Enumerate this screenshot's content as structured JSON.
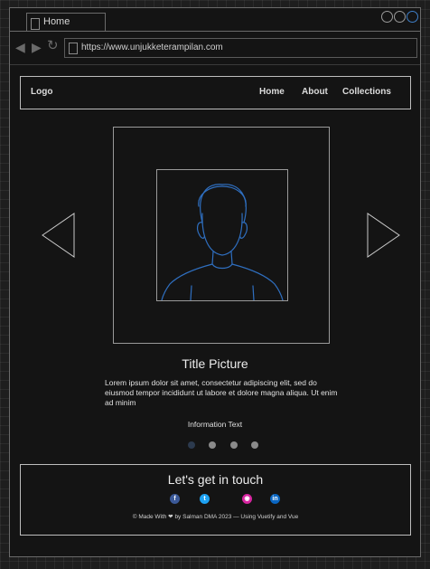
{
  "browser": {
    "tab_title": "Home",
    "url": "https://www.unjukketerampilan.com"
  },
  "header": {
    "logo": "Logo",
    "nav": [
      "Home",
      "About",
      "Collections"
    ]
  },
  "carousel": {
    "title": "Title Picture",
    "description": "Lorem ipsum dolor sit amet, consectetur adipiscing elit, sed do eiusmod tempor incididunt ut labore et dolore magna aliqua. Ut enim ad minim",
    "info": "Information Text",
    "slide_count": 4,
    "active_slide": 1
  },
  "footer": {
    "heading": "Let's get in touch",
    "social": [
      "facebook",
      "twitter",
      "instagram",
      "linkedin"
    ],
    "credit": "© Made With ❤ by Salman DMA 2023 — Using Vuetify and Vue"
  },
  "colors": {
    "facebook": "#3b5998",
    "twitter": "#1da1f2",
    "instagram": "#d6249f",
    "linkedin": "#0a66c2",
    "avatar_stroke": "#2f6fc0"
  }
}
